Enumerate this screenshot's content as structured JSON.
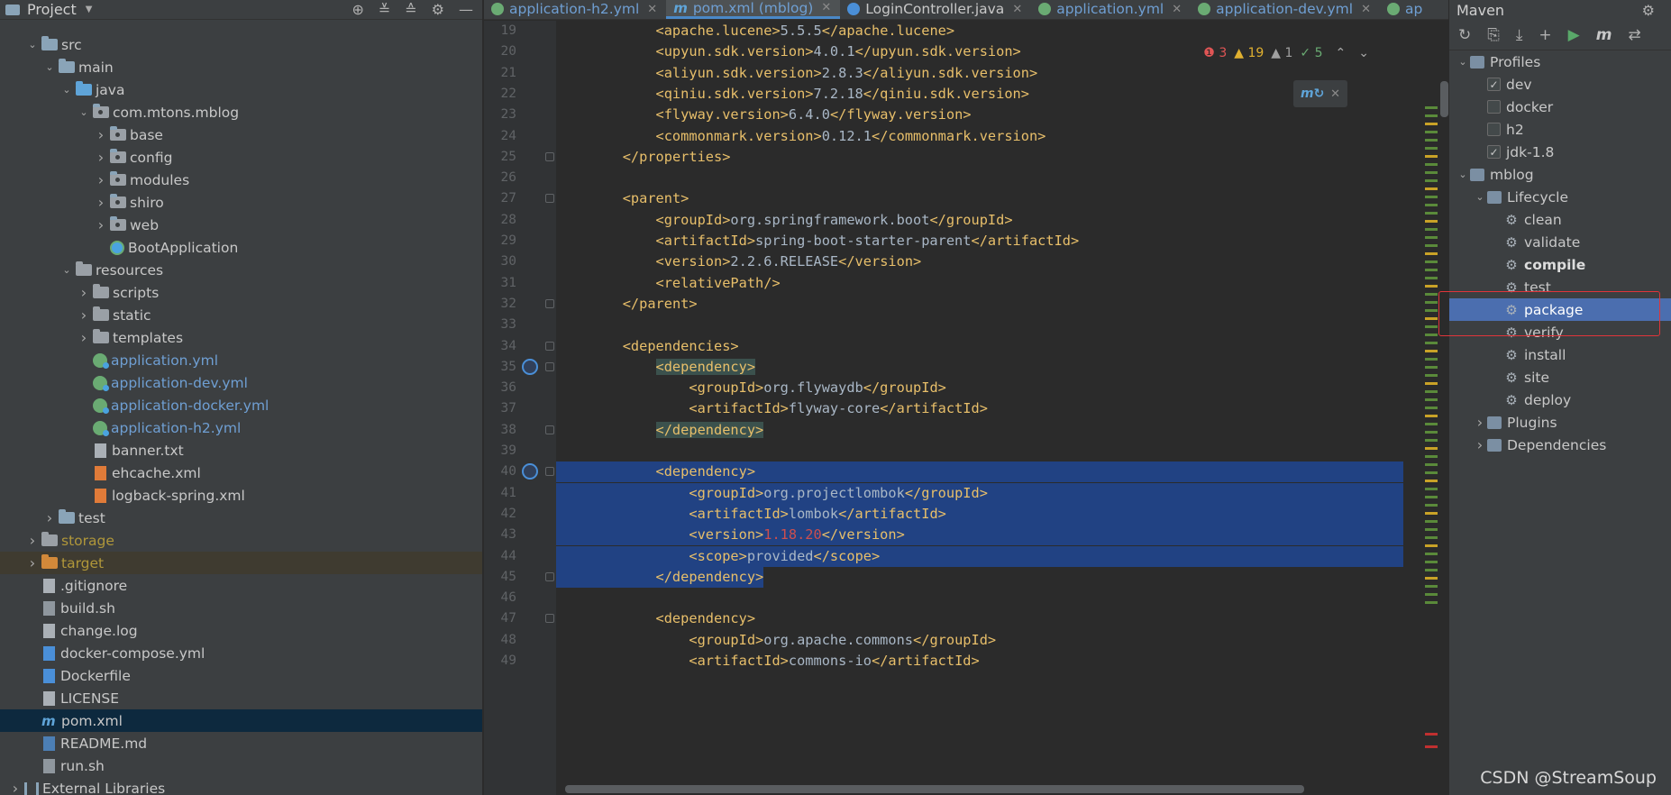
{
  "project": {
    "title": "Project",
    "tree": [
      {
        "label": "",
        "depth": 3,
        "arrow": "",
        "icon": "none",
        "kind": "partial"
      },
      {
        "label": "src",
        "depth": 2,
        "arrow": "open",
        "icon": "fold",
        "kind": ""
      },
      {
        "label": "main",
        "depth": 3,
        "arrow": "open",
        "icon": "fold",
        "kind": ""
      },
      {
        "label": "java",
        "depth": 4,
        "arrow": "open",
        "icon": "fold blue",
        "kind": ""
      },
      {
        "label": "com.mtons.mblog",
        "depth": 5,
        "arrow": "open",
        "icon": "fold pkg",
        "kind": ""
      },
      {
        "label": "base",
        "depth": 6,
        "arrow": "closed",
        "icon": "fold pkg",
        "kind": ""
      },
      {
        "label": "config",
        "depth": 6,
        "arrow": "closed",
        "icon": "fold pkg",
        "kind": ""
      },
      {
        "label": "modules",
        "depth": 6,
        "arrow": "closed",
        "icon": "fold pkg",
        "kind": ""
      },
      {
        "label": "shiro",
        "depth": 6,
        "arrow": "closed",
        "icon": "fold pkg",
        "kind": ""
      },
      {
        "label": "web",
        "depth": 6,
        "arrow": "closed",
        "icon": "fold pkg",
        "kind": ""
      },
      {
        "label": "BootApplication",
        "depth": 6,
        "arrow": "",
        "icon": "springapp",
        "kind": ""
      },
      {
        "label": "resources",
        "depth": 4,
        "arrow": "open",
        "icon": "fold gray",
        "kind": ""
      },
      {
        "label": "scripts",
        "depth": 5,
        "arrow": "closed",
        "icon": "fold gray",
        "kind": ""
      },
      {
        "label": "static",
        "depth": 5,
        "arrow": "closed",
        "icon": "fold gray",
        "kind": ""
      },
      {
        "label": "templates",
        "depth": 5,
        "arrow": "closed",
        "icon": "fold gray",
        "kind": ""
      },
      {
        "label": "application.yml",
        "depth": 5,
        "arrow": "",
        "icon": "spring",
        "kind": "cfg"
      },
      {
        "label": "application-dev.yml",
        "depth": 5,
        "arrow": "",
        "icon": "spring",
        "kind": "cfg"
      },
      {
        "label": "application-docker.yml",
        "depth": 5,
        "arrow": "",
        "icon": "spring",
        "kind": "cfg"
      },
      {
        "label": "application-h2.yml",
        "depth": 5,
        "arrow": "",
        "icon": "spring",
        "kind": "cfg"
      },
      {
        "label": "banner.txt",
        "depth": 5,
        "arrow": "",
        "icon": "file",
        "kind": ""
      },
      {
        "label": "ehcache.xml",
        "depth": 5,
        "arrow": "",
        "icon": "xml",
        "kind": ""
      },
      {
        "label": "logback-spring.xml",
        "depth": 5,
        "arrow": "",
        "icon": "xml",
        "kind": ""
      },
      {
        "label": "test",
        "depth": 3,
        "arrow": "closed",
        "icon": "fold",
        "kind": ""
      },
      {
        "label": "storage",
        "depth": 2,
        "arrow": "closed",
        "icon": "fold gray",
        "kind": "ignored"
      },
      {
        "label": "target",
        "depth": 2,
        "arrow": "closed",
        "icon": "fold orange",
        "kind": "ignored target"
      },
      {
        "label": ".gitignore",
        "depth": 2,
        "arrow": "",
        "icon": "file",
        "kind": ""
      },
      {
        "label": "build.sh",
        "depth": 2,
        "arrow": "",
        "icon": "sh",
        "kind": ""
      },
      {
        "label": "change.log",
        "depth": 2,
        "arrow": "",
        "icon": "file",
        "kind": ""
      },
      {
        "label": "docker-compose.yml",
        "depth": 2,
        "arrow": "",
        "icon": "docker",
        "kind": ""
      },
      {
        "label": "Dockerfile",
        "depth": 2,
        "arrow": "",
        "icon": "docker",
        "kind": ""
      },
      {
        "label": "LICENSE",
        "depth": 2,
        "arrow": "",
        "icon": "file",
        "kind": ""
      },
      {
        "label": "pom.xml",
        "depth": 2,
        "arrow": "",
        "icon": "m",
        "kind": "pom"
      },
      {
        "label": "README.md",
        "depth": 2,
        "arrow": "",
        "icon": "md",
        "kind": ""
      },
      {
        "label": "run.sh",
        "depth": 2,
        "arrow": "",
        "icon": "sh",
        "kind": ""
      },
      {
        "label": "External Libraries",
        "depth": 1,
        "arrow": "closed",
        "icon": "lib",
        "kind": ""
      }
    ]
  },
  "tabs": [
    {
      "label": "application-h2.yml",
      "icon": "spring",
      "active": false,
      "plain": false
    },
    {
      "label": "pom.xml (mblog)",
      "icon": "m",
      "active": true,
      "plain": false
    },
    {
      "label": "LoginController.java",
      "icon": "class",
      "active": false,
      "plain": true
    },
    {
      "label": "application.yml",
      "icon": "spring",
      "active": false,
      "plain": false
    },
    {
      "label": "application-dev.yml",
      "icon": "spring",
      "active": false,
      "plain": false
    },
    {
      "label": "ap",
      "icon": "spring",
      "active": false,
      "plain": false
    }
  ],
  "inspections": {
    "errors": "3",
    "warnings": "19",
    "weak": "1",
    "ok": "5"
  },
  "maven_popup_icon": "m-refresh",
  "code": {
    "lines": [
      {
        "n": "19",
        "indent": 2,
        "open": "apache.lucene",
        "text": "5.5.5",
        "sel": false
      },
      {
        "n": "20",
        "indent": 2,
        "open": "upyun.sdk.version",
        "text": "4.0.1",
        "sel": false
      },
      {
        "n": "21",
        "indent": 2,
        "open": "aliyun.sdk.version",
        "text": "2.8.3",
        "sel": false
      },
      {
        "n": "22",
        "indent": 2,
        "open": "qiniu.sdk.version",
        "text": "7.2.18",
        "sel": false
      },
      {
        "n": "23",
        "indent": 2,
        "open": "flyway.version",
        "text": "6.4.0",
        "sel": false
      },
      {
        "n": "24",
        "indent": 2,
        "open": "commonmark.version",
        "text": "0.12.1",
        "sel": false
      },
      {
        "n": "25",
        "indent": 1,
        "close": "properties",
        "sel": false,
        "fold": true
      },
      {
        "n": "26",
        "sel": false
      },
      {
        "n": "27",
        "indent": 1,
        "openonly": "parent",
        "sel": false,
        "fold": true
      },
      {
        "n": "28",
        "indent": 2,
        "open": "groupId",
        "text": "org.springframework.boot",
        "sel": false
      },
      {
        "n": "29",
        "indent": 2,
        "open": "artifactId",
        "text": "spring-boot-starter-parent",
        "sel": false
      },
      {
        "n": "30",
        "indent": 2,
        "open": "version",
        "text": "2.2.6.RELEASE",
        "sel": false
      },
      {
        "n": "31",
        "indent": 2,
        "selfclose": "relativePath",
        "sel": false
      },
      {
        "n": "32",
        "indent": 1,
        "close": "parent",
        "sel": false,
        "fold": true
      },
      {
        "n": "33",
        "sel": false
      },
      {
        "n": "34",
        "indent": 1,
        "openonly": "dependencies",
        "sel": false,
        "fold": true
      },
      {
        "n": "35",
        "indent": 2,
        "openonly": "dependency",
        "sel": false,
        "fold": true,
        "gutter": true,
        "hl": true
      },
      {
        "n": "36",
        "indent": 3,
        "open": "groupId",
        "text": "org.flywaydb",
        "sel": false
      },
      {
        "n": "37",
        "indent": 3,
        "open": "artifactId",
        "text": "flyway-core",
        "sel": false
      },
      {
        "n": "38",
        "indent": 2,
        "close": "dependency",
        "sel": false,
        "fold": true,
        "hl": true
      },
      {
        "n": "39",
        "sel": false
      },
      {
        "n": "40",
        "indent": 2,
        "openonly": "dependency",
        "sel": true,
        "fold": true,
        "gutter": true
      },
      {
        "n": "41",
        "indent": 3,
        "open": "groupId",
        "text": "org.projectlombok",
        "sel": true
      },
      {
        "n": "42",
        "indent": 3,
        "open": "artifactId",
        "text": "lombok",
        "sel": true
      },
      {
        "n": "43",
        "indent": 3,
        "open": "version",
        "text": "1.18.20",
        "sel": true,
        "num": true
      },
      {
        "n": "44",
        "indent": 3,
        "open": "scope",
        "text": "provided",
        "sel": true
      },
      {
        "n": "45",
        "indent": 2,
        "close": "dependency",
        "sel": "partial",
        "fold": true
      },
      {
        "n": "46",
        "sel": false
      },
      {
        "n": "47",
        "indent": 2,
        "openonly": "dependency",
        "sel": false,
        "fold": true
      },
      {
        "n": "48",
        "indent": 3,
        "open": "groupId",
        "text": "org.apache.commons",
        "sel": false
      },
      {
        "n": "49",
        "indent": 3,
        "open": "artifactId",
        "text": "commons-io",
        "sel": false
      }
    ]
  },
  "maven": {
    "title": "Maven",
    "rows": [
      {
        "label": "Profiles",
        "depth": 1,
        "arrow": "open",
        "icon": "mavico",
        "type": "node"
      },
      {
        "label": "dev",
        "depth": 2,
        "arrow": "",
        "type": "check",
        "checked": true
      },
      {
        "label": "docker",
        "depth": 2,
        "arrow": "",
        "type": "check",
        "checked": false
      },
      {
        "label": "h2",
        "depth": 2,
        "arrow": "",
        "type": "check",
        "checked": false
      },
      {
        "label": "jdk-1.8",
        "depth": 2,
        "arrow": "",
        "type": "check",
        "checked": true
      },
      {
        "label": "mblog",
        "depth": 1,
        "arrow": "open",
        "icon": "mavico",
        "type": "node"
      },
      {
        "label": "Lifecycle",
        "depth": 2,
        "arrow": "open",
        "icon": "mavico",
        "type": "node"
      },
      {
        "label": "clean",
        "depth": 3,
        "arrow": "",
        "type": "goal"
      },
      {
        "label": "validate",
        "depth": 3,
        "arrow": "",
        "type": "goal"
      },
      {
        "label": "compile",
        "depth": 3,
        "arrow": "",
        "type": "goal",
        "bold": true
      },
      {
        "label": "test",
        "depth": 3,
        "arrow": "",
        "type": "goal"
      },
      {
        "label": "package",
        "depth": 3,
        "arrow": "",
        "type": "goal",
        "selected": true
      },
      {
        "label": "verify",
        "depth": 3,
        "arrow": "",
        "type": "goal"
      },
      {
        "label": "install",
        "depth": 3,
        "arrow": "",
        "type": "goal"
      },
      {
        "label": "site",
        "depth": 3,
        "arrow": "",
        "type": "goal"
      },
      {
        "label": "deploy",
        "depth": 3,
        "arrow": "",
        "type": "goal"
      },
      {
        "label": "Plugins",
        "depth": 2,
        "arrow": "closed",
        "icon": "mavico",
        "type": "node"
      },
      {
        "label": "Dependencies",
        "depth": 2,
        "arrow": "closed",
        "icon": "mavico",
        "type": "node"
      }
    ]
  },
  "watermark": "CSDN @StreamSoup"
}
